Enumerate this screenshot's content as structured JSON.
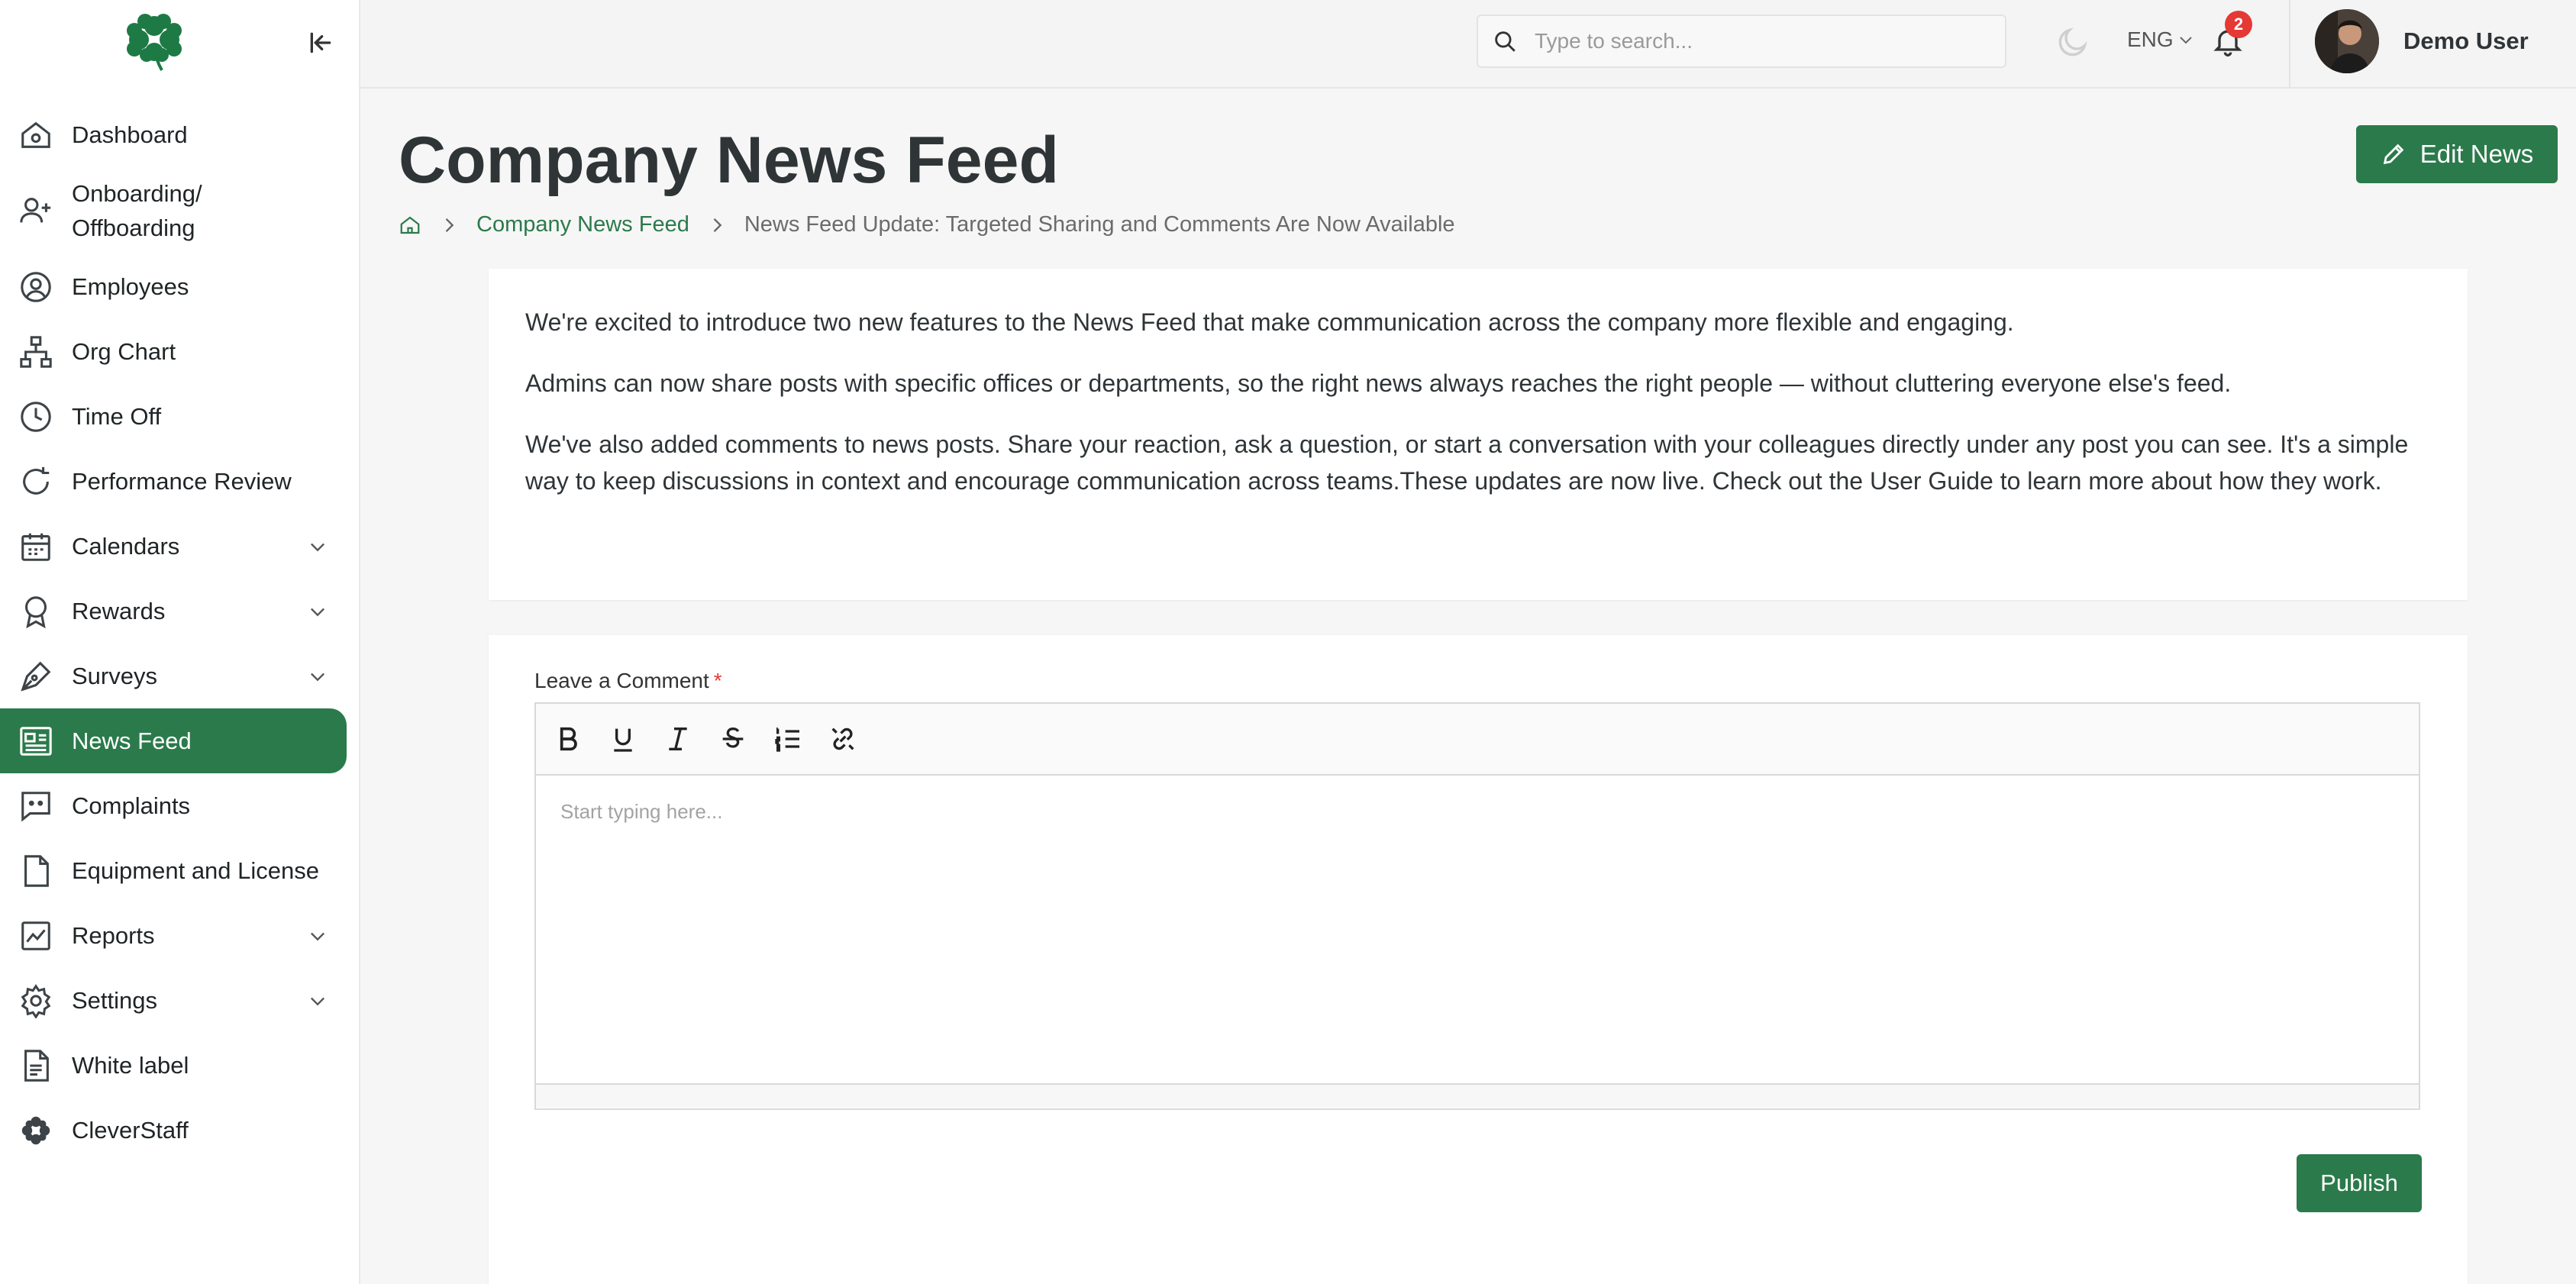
{
  "sidebar": {
    "items": [
      {
        "label": "Dashboard",
        "icon": "home-icon"
      },
      {
        "label": "Onboarding/\nOffboarding",
        "icon": "user-plus-icon"
      },
      {
        "label": "Employees",
        "icon": "user-circle-icon"
      },
      {
        "label": "Org Chart",
        "icon": "org-chart-icon"
      },
      {
        "label": "Time Off",
        "icon": "clock-icon"
      },
      {
        "label": "Performance Review",
        "icon": "refresh-icon"
      },
      {
        "label": "Calendars",
        "icon": "calendar-icon",
        "has_submenu": true
      },
      {
        "label": "Rewards",
        "icon": "award-icon",
        "has_submenu": true
      },
      {
        "label": "Surveys",
        "icon": "pen-tool-icon",
        "has_submenu": true
      },
      {
        "label": "News Feed",
        "icon": "newspaper-icon",
        "active": true
      },
      {
        "label": "Complaints",
        "icon": "message-square-icon"
      },
      {
        "label": "Equipment and License",
        "icon": "file-icon"
      },
      {
        "label": "Reports",
        "icon": "chart-icon",
        "has_submenu": true
      },
      {
        "label": "Settings",
        "icon": "gear-icon",
        "has_submenu": true
      },
      {
        "label": "White label",
        "icon": "document-icon"
      },
      {
        "label": "CleverStaff",
        "icon": "cleverstaff-icon"
      }
    ]
  },
  "topbar": {
    "search_placeholder": "Type to search...",
    "language": "ENG",
    "notification_count": "2",
    "user_name": "Demo User"
  },
  "header": {
    "title": "Company News Feed",
    "edit_button": "Edit News",
    "breadcrumb": {
      "link": "Company News Feed",
      "current": "News Feed Update: Targeted Sharing and Comments Are Now Available"
    }
  },
  "article": {
    "paragraphs": [
      "We're excited to introduce two new features to the News Feed that make communication across the company more flexible and engaging.",
      "Admins can now share posts with specific offices or departments, so the right news always reaches the right people — without cluttering everyone else's feed.",
      "We've also added comments to news posts. Share your reaction, ask a question, or start a conversation with your colleagues directly under any post you can see. It's a simple way to keep discussions in context and encourage communication across teams.These updates are now live. Check out the User Guide to learn more about how they work."
    ]
  },
  "comment": {
    "label": "Leave a Comment",
    "required_mark": "*",
    "placeholder": "Start typing here...",
    "publish_button": "Publish"
  },
  "colors": {
    "brand_green": "#2b7a4b",
    "badge_red": "#e53935"
  }
}
